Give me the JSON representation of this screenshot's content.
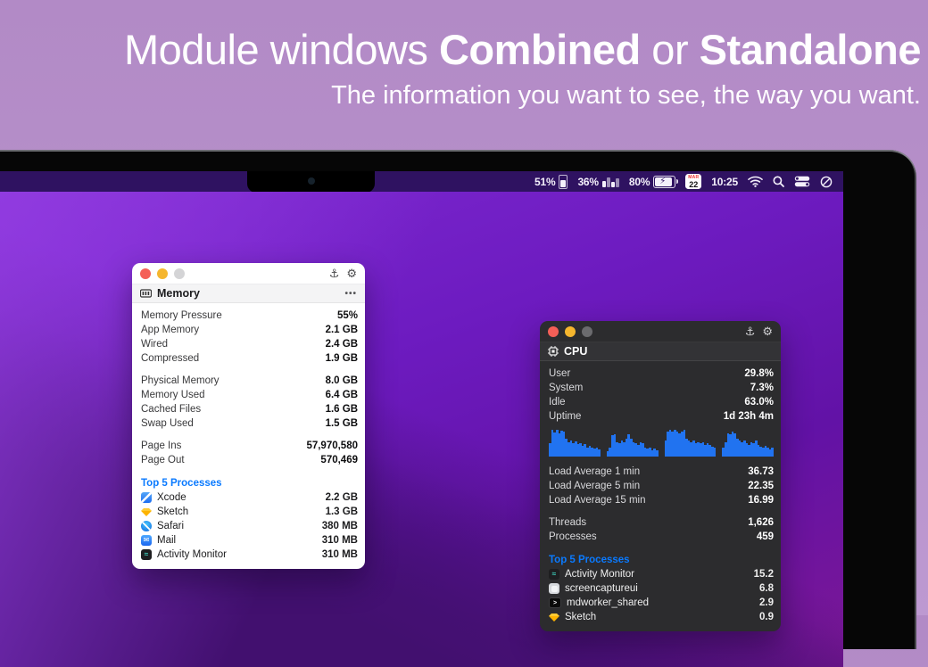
{
  "hero": {
    "title_seg1": "Module windows ",
    "title_seg2": "Combined",
    "title_seg3": " or ",
    "title_seg4": "Standalone",
    "subtitle": "The information you want to see, the way you want."
  },
  "menubar": {
    "memory_pct": "51%",
    "cpu_pct": "36%",
    "battery_pct": "80%",
    "date_month": "MAR",
    "date_day": "22",
    "time": "10:25"
  },
  "memory_window": {
    "title": "Memory",
    "more_label": "•••",
    "stats1": [
      {
        "label": "Memory Pressure",
        "value": "55%"
      },
      {
        "label": "App Memory",
        "value": "2.1 GB"
      },
      {
        "label": "Wired",
        "value": "2.4 GB"
      },
      {
        "label": "Compressed",
        "value": "1.9 GB"
      }
    ],
    "stats2": [
      {
        "label": "Physical Memory",
        "value": "8.0 GB"
      },
      {
        "label": "Memory Used",
        "value": "6.4 GB"
      },
      {
        "label": "Cached Files",
        "value": "1.6 GB"
      },
      {
        "label": "Swap Used",
        "value": "1.5 GB"
      }
    ],
    "stats3": [
      {
        "label": "Page Ins",
        "value": "57,970,580"
      },
      {
        "label": "Page Out",
        "value": "570,469"
      }
    ],
    "processes_header": "Top 5 Processes",
    "processes": [
      {
        "name": "Xcode",
        "value": "2.2 GB",
        "icon": "icon-xcode",
        "glyph": ""
      },
      {
        "name": "Sketch",
        "value": "1.3 GB",
        "icon": "icon-sketch",
        "glyph": ""
      },
      {
        "name": "Safari",
        "value": "380 MB",
        "icon": "icon-safari",
        "glyph": ""
      },
      {
        "name": "Mail",
        "value": "310 MB",
        "icon": "icon-mail",
        "glyph": "✉"
      },
      {
        "name": "Activity Monitor",
        "value": "310 MB",
        "icon": "icon-activity",
        "glyph": "≈"
      }
    ],
    "accent_blue": "#0a7aff"
  },
  "cpu_window": {
    "title": "CPU",
    "stats1": [
      {
        "label": "User",
        "value": "29.8%"
      },
      {
        "label": "System",
        "value": "7.3%"
      },
      {
        "label": "Idle",
        "value": "63.0%"
      },
      {
        "label": "Uptime",
        "value": "1d 23h 4m"
      }
    ],
    "chart_data": {
      "type": "area",
      "color": "#2173f0",
      "series": [
        [
          0.45,
          0.9,
          0.82,
          0.92,
          0.8,
          0.88,
          0.85,
          0.62,
          0.5,
          0.56,
          0.46,
          0.52,
          0.42,
          0.46,
          0.36,
          0.42,
          0.3,
          0.36,
          0.3,
          0.26,
          0.3,
          0.24
        ],
        [
          0.18,
          0.3,
          0.72,
          0.76,
          0.5,
          0.44,
          0.56,
          0.5,
          0.62,
          0.76,
          0.6,
          0.5,
          0.44,
          0.4,
          0.5,
          0.44,
          0.3,
          0.26,
          0.3,
          0.2,
          0.26,
          0.2
        ],
        [
          0.55,
          0.86,
          0.92,
          0.86,
          0.9,
          0.84,
          0.8,
          0.86,
          0.9,
          0.6,
          0.56,
          0.5,
          0.56,
          0.46,
          0.5,
          0.46,
          0.5,
          0.4,
          0.46,
          0.4,
          0.34,
          0.3
        ],
        [
          0.3,
          0.5,
          0.8,
          0.76,
          0.86,
          0.8,
          0.6,
          0.56,
          0.5,
          0.56,
          0.46,
          0.4,
          0.5,
          0.46,
          0.56,
          0.4,
          0.34,
          0.3,
          0.36,
          0.3,
          0.24,
          0.3
        ]
      ]
    },
    "stats2": [
      {
        "label": "Load Average 1 min",
        "value": "36.73"
      },
      {
        "label": "Load Average 5 min",
        "value": "22.35"
      },
      {
        "label": "Load Average 15 min",
        "value": "16.99"
      }
    ],
    "stats3": [
      {
        "label": "Threads",
        "value": "1,626"
      },
      {
        "label": "Processes",
        "value": "459"
      }
    ],
    "processes_header": "Top 5 Processes",
    "processes": [
      {
        "name": "Activity Monitor",
        "value": "15.2",
        "icon": "icon-activity",
        "glyph": "≈"
      },
      {
        "name": "screencaptureui",
        "value": "6.8",
        "icon": "icon-screencap",
        "glyph": ""
      },
      {
        "name": "mdworker_shared",
        "value": "2.9",
        "icon": "icon-terminal",
        "glyph": ">"
      },
      {
        "name": "Sketch",
        "value": "0.9",
        "icon": "icon-sketch",
        "glyph": ""
      }
    ],
    "accent_blue": "#0a7aff"
  },
  "window_controls": {
    "pin_icon": "⚓",
    "gear_icon": "⚙"
  }
}
